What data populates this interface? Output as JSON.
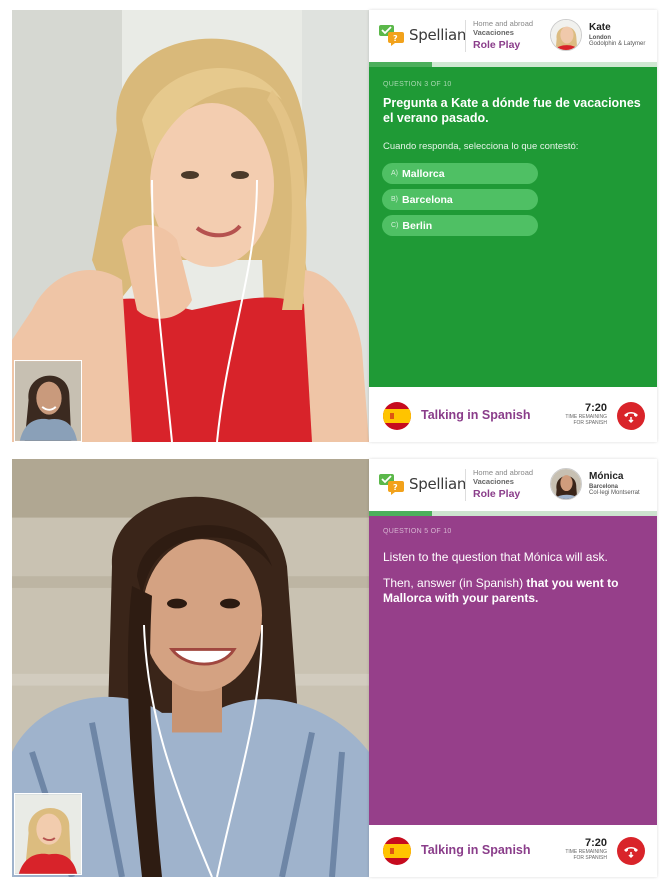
{
  "colors": {
    "brand_purple": "#8a3d8a",
    "green_question": "#1f9a36",
    "purple_question": "#963f8a",
    "option_green": "#4fc064",
    "hangup_red": "#d9242a"
  },
  "sessions": [
    {
      "header": {
        "logo_text": "Spellian",
        "lesson_line1": "Home and abroad",
        "lesson_line2": "Vacaciones",
        "lesson_mode": "Role Play",
        "tutor_name": "Kate",
        "tutor_location": "London",
        "tutor_school": "Godolphin & Latymer"
      },
      "progress_fraction": 0.22,
      "question_number": "QUESTION 3 OF 10",
      "question_title": "Pregunta a Kate a dónde fue de vacaciones el verano pasado.",
      "prompt": "Cuando responda, selecciona lo que contestó:",
      "options": [
        {
          "letter": "A)",
          "text": "Mallorca"
        },
        {
          "letter": "B)",
          "text": "Barcelona"
        },
        {
          "letter": "C)",
          "text": "Berlin"
        }
      ],
      "footer": {
        "talking_label": "Talking in Spanish",
        "time": "7:20",
        "time_label": "TIME REMAINING FOR SPANISH",
        "flag_icon": "spain-flag-icon",
        "hangup_icon": "phone-hangup-icon"
      }
    },
    {
      "header": {
        "logo_text": "Spellian",
        "lesson_line1": "Home and abroad",
        "lesson_line2": "Vacaciones",
        "lesson_mode": "Role Play",
        "tutor_name": "Mónica",
        "tutor_location": "Barcelona",
        "tutor_school": "Col·legi Montserrat"
      },
      "progress_fraction": 0.22,
      "question_number": "QUESTION 5 OF 10",
      "instruction_1": "Listen to the question that Mónica will ask.",
      "instruction_2_prefix": "Then, answer (in Spanish) ",
      "instruction_2_bold": "that you went to Mallorca with your parents.",
      "footer": {
        "talking_label": "Talking in Spanish",
        "time": "7:20",
        "time_label": "TIME REMAINING FOR SPANISH",
        "flag_icon": "spain-flag-icon",
        "hangup_icon": "phone-hangup-icon"
      }
    }
  ]
}
